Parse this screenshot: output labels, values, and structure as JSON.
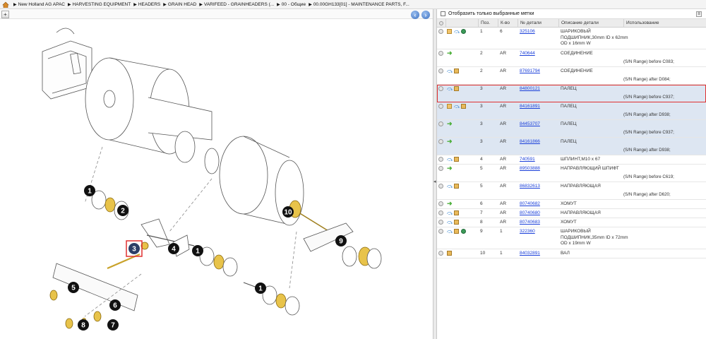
{
  "breadcrumb": {
    "items": [
      "New Holland AG APAC",
      "HARVESTING EQUIPMENT",
      "HEADERS",
      "GRAIN HEAD",
      "VARIFEED - GRAINHEADERS (...",
      "00 - Общие",
      "00.00GH133[01] - MAINTENANCE PARTS, F..."
    ]
  },
  "diagram": {
    "callouts": [
      "1",
      "2",
      "3",
      "4",
      "1",
      "1",
      "5",
      "6",
      "7",
      "8",
      "9",
      "10"
    ],
    "selected_callout": "3"
  },
  "filter": {
    "label": "Отобразить только выбранные метки",
    "checked": false
  },
  "table": {
    "headers": [
      "Поз.",
      "К-во",
      "№ детали",
      "Описание детали",
      "Использование"
    ],
    "rows": [
      {
        "pos": "1",
        "qty": "6",
        "part": "325106",
        "desc": [
          "ШАРИКОВЫЙ",
          "ПОДШИПНИК,30mm ID x 62mm",
          "OD x 16mm W"
        ],
        "note": "",
        "icons": [
          "circle",
          "book",
          "arrow",
          "globe"
        ],
        "alt": false,
        "selected": false
      },
      {
        "pos": "2",
        "qty": "AR",
        "part": "740644",
        "desc": [
          "СОЕДИНЕНИЕ"
        ],
        "note": "(S/N Range) before C083;",
        "icons": [
          "circle",
          "green"
        ],
        "alt": false,
        "selected": false
      },
      {
        "pos": "2",
        "qty": "AR",
        "part": "87691794",
        "desc": [
          "СОЕДИНЕНИЕ"
        ],
        "note": "(S/N Range) after D084;",
        "icons": [
          "circle",
          "arrow",
          "box"
        ],
        "alt": false,
        "selected": false
      },
      {
        "pos": "3",
        "qty": "AR",
        "part": "84800121",
        "desc": [
          "ПАЛЕЦ"
        ],
        "note": "(S/N Range) before C937;",
        "icons": [
          "circle",
          "arrow",
          "box"
        ],
        "alt": true,
        "selected": true
      },
      {
        "pos": "3",
        "qty": "AR",
        "part": "84161891",
        "desc": [
          "ПАЛЕЦ"
        ],
        "note": "(S/N Range) after D938;",
        "icons": [
          "circle",
          "book",
          "arrow",
          "box"
        ],
        "alt": true,
        "selected": false
      },
      {
        "pos": "3",
        "qty": "AR",
        "part": "84453707",
        "desc": [
          "ПАЛЕЦ"
        ],
        "note": "(S/N Range) before C937;",
        "icons": [
          "circle",
          "green"
        ],
        "alt": true,
        "selected": false
      },
      {
        "pos": "3",
        "qty": "AR",
        "part": "84161866",
        "desc": [
          "ПАЛЕЦ"
        ],
        "note": "(S/N Range) after D938;",
        "icons": [
          "circle",
          "green"
        ],
        "alt": true,
        "selected": false
      },
      {
        "pos": "4",
        "qty": "AR",
        "part": "740591",
        "desc": [
          "ШПЛИНТ,M10 x 67"
        ],
        "note": "",
        "icons": [
          "circle",
          "arrow",
          "box"
        ],
        "alt": false,
        "selected": false
      },
      {
        "pos": "5",
        "qty": "AR",
        "part": "89503888",
        "desc": [
          "НАПРАВЛЯЮЩИЙ ШПИФТ"
        ],
        "note": "(S/N Range) before C619;",
        "icons": [
          "circle",
          "green"
        ],
        "alt": false,
        "selected": false
      },
      {
        "pos": "5",
        "qty": "AR",
        "part": "86832613",
        "desc": [
          "НАПРАВЛЯЮЩАЯ"
        ],
        "note": "(S/N Range) after D620;",
        "icons": [
          "circle",
          "arrow",
          "box"
        ],
        "alt": false,
        "selected": false
      },
      {
        "pos": "6",
        "qty": "AR",
        "part": "80740682",
        "desc": [
          "ХОМУТ"
        ],
        "note": "",
        "icons": [
          "circle",
          "green"
        ],
        "alt": false,
        "selected": false
      },
      {
        "pos": "7",
        "qty": "AR",
        "part": "80740680",
        "desc": [
          "НАПРАВЛЯЮЩАЯ"
        ],
        "note": "",
        "icons": [
          "circle",
          "arrow",
          "box"
        ],
        "alt": false,
        "selected": false
      },
      {
        "pos": "8",
        "qty": "AR",
        "part": "80740683",
        "desc": [
          "ХОМУТ"
        ],
        "note": "",
        "icons": [
          "circle",
          "arrow",
          "box"
        ],
        "alt": false,
        "selected": false
      },
      {
        "pos": "9",
        "qty": "1",
        "part": "322360",
        "desc": [
          "ШАРИКОВЫЙ",
          "ПОДШИПНИК,35mm ID x 72mm",
          "OD x 19mm W"
        ],
        "note": "",
        "icons": [
          "circle",
          "arrow",
          "box",
          "globe"
        ],
        "alt": false,
        "selected": false
      },
      {
        "pos": "10",
        "qty": "1",
        "part": "84032891",
        "desc": [
          "ВАЛ"
        ],
        "note": "",
        "icons": [
          "circle",
          "box"
        ],
        "alt": false,
        "selected": false
      }
    ]
  },
  "colors": {
    "alt_row": "#dde6f2",
    "selected_border": "#e03030",
    "link": "#1a3fd9"
  }
}
